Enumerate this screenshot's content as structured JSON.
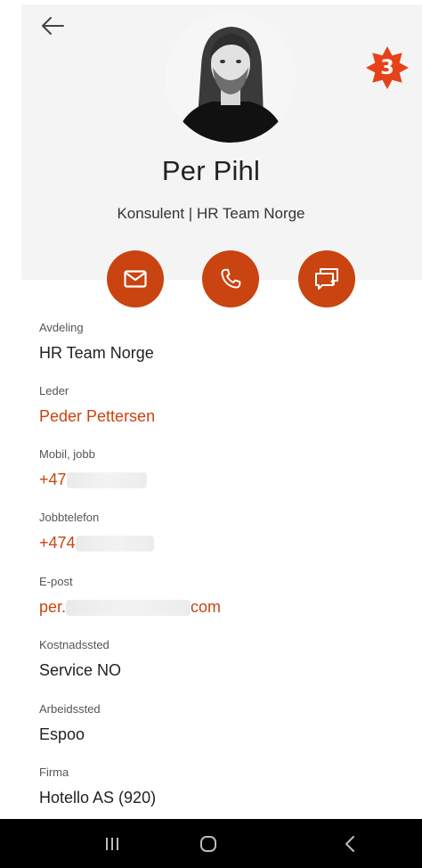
{
  "profile": {
    "name": "Per Pihl",
    "subtitle": "Konsulent | HR Team Norge",
    "badge_count": "3"
  },
  "actions": [
    {
      "icon": "mail-icon"
    },
    {
      "icon": "phone-icon"
    },
    {
      "icon": "chat-icon"
    }
  ],
  "fields": {
    "avdeling": {
      "label": "Avdeling",
      "value": "HR Team Norge"
    },
    "leder": {
      "label": "Leder",
      "value": "Peder Pettersen"
    },
    "mobil": {
      "label": "Mobil, jobb",
      "value_prefix": "+47"
    },
    "jobbtelefon": {
      "label": "Jobbtelefon",
      "value_prefix": "+474"
    },
    "epost": {
      "label": "E-post",
      "value_prefix": "per.",
      "value_suffix": "com"
    },
    "kostnadssted": {
      "label": "Kostnadssted",
      "value": "Service NO"
    },
    "arbeidssted": {
      "label": "Arbeidssted",
      "value": "Espoo"
    },
    "firma": {
      "label": "Firma",
      "value": "Hotello AS (920)"
    }
  },
  "colors": {
    "accent": "#c94410",
    "header_bg": "#f4f4f4",
    "navbar_bg": "#000000"
  }
}
